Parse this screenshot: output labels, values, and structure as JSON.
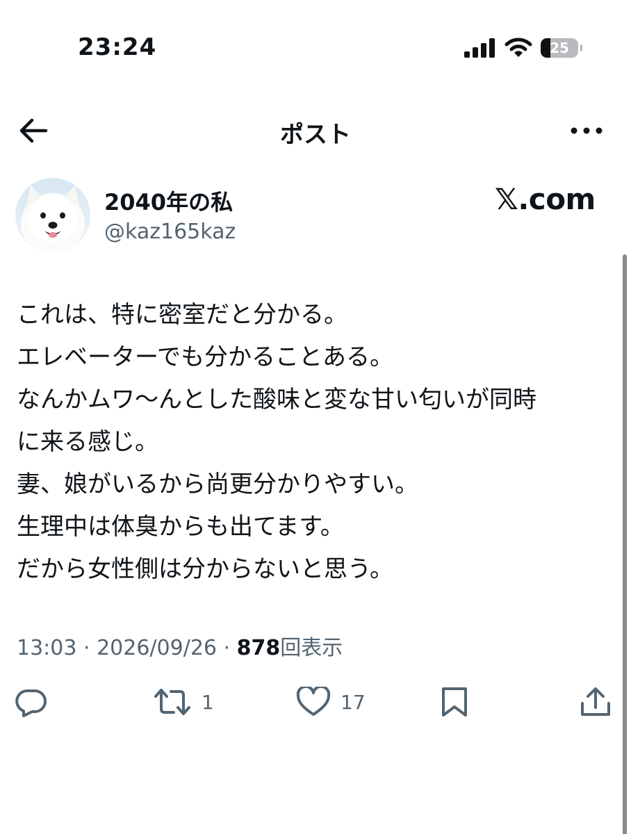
{
  "status_bar": {
    "time": "23:24",
    "battery": "25",
    "icons": [
      "cellular-signal-icon",
      "wifi-icon",
      "battery-icon"
    ]
  },
  "header": {
    "title": "ポスト",
    "back_icon": "back-arrow-icon",
    "more_icon": "more-options-icon"
  },
  "author": {
    "display_name": "2040年の私",
    "handle": "@kaz165kaz",
    "site_brand": "𝕏.com"
  },
  "post": {
    "lines": [
      "これは、特に密室だと分かる。",
      "エレベーターでも分かることある。",
      "なんかムワ〜んとした酸味と変な甘い匂いが同時",
      "に来る感じ。",
      "妻、娘がいるから尚更分かりやすい。",
      "生理中は体臭からも出てます。",
      "だから女性側は分からないと思う。"
    ]
  },
  "meta": {
    "time": "13:03",
    "separator": " · ",
    "date": "2026/09/26",
    "views_count": "878",
    "views_label": "回表示"
  },
  "actions": {
    "reply_icon": "reply-icon",
    "repost_count": "1",
    "like_count": "17",
    "bookmark_icon": "bookmark-icon",
    "share_icon": "share-icon"
  },
  "colors": {
    "text_primary": "#0f1419",
    "text_secondary": "#536471",
    "background": "#ffffff"
  }
}
